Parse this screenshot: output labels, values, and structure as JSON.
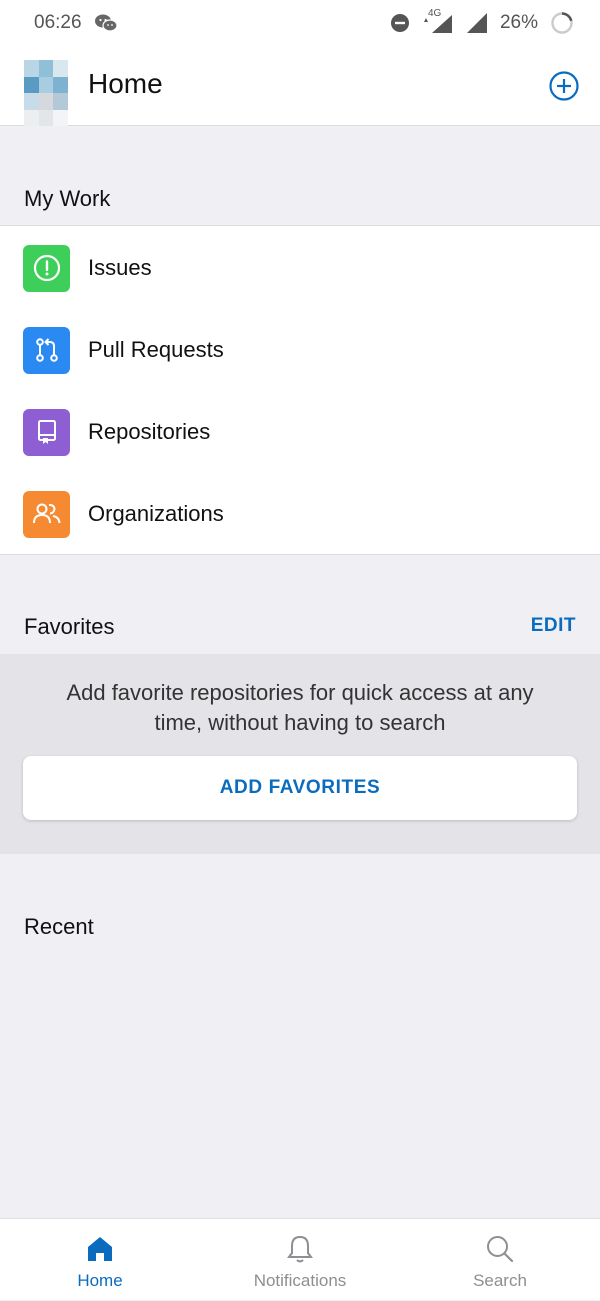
{
  "status_bar": {
    "time": "06:26",
    "network": "4G",
    "battery": "26%"
  },
  "header": {
    "title": "Home"
  },
  "my_work": {
    "heading": "My Work",
    "items": [
      {
        "label": "Issues",
        "icon": "issues-icon",
        "color": "#3ecf5a"
      },
      {
        "label": "Pull Requests",
        "icon": "pull-request-icon",
        "color": "#2b8af2"
      },
      {
        "label": "Repositories",
        "icon": "repository-icon",
        "color": "#8d5fd3"
      },
      {
        "label": "Organizations",
        "icon": "organizations-icon",
        "color": "#f58a33"
      }
    ]
  },
  "favorites": {
    "heading": "Favorites",
    "edit_label": "EDIT",
    "message": "Add favorite repositories for quick access at any time, without having to search",
    "add_button_label": "ADD FAVORITES"
  },
  "recent": {
    "heading": "Recent"
  },
  "bottom_nav": {
    "tabs": [
      {
        "label": "Home",
        "icon": "home-icon",
        "active": true
      },
      {
        "label": "Notifications",
        "icon": "bell-icon",
        "active": false
      },
      {
        "label": "Search",
        "icon": "search-icon",
        "active": false
      }
    ]
  },
  "colors": {
    "accent": "#0b6cbf",
    "background": "#efeff4",
    "panel": "#e4e4e8"
  }
}
